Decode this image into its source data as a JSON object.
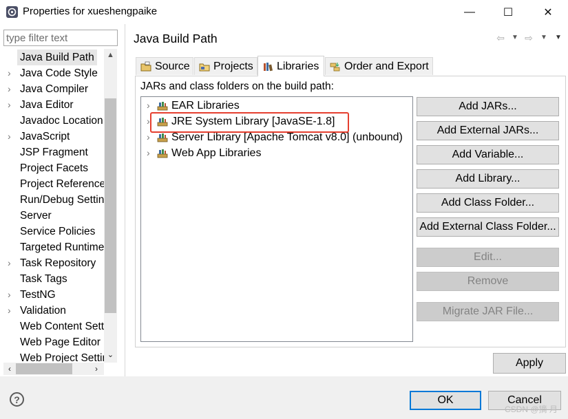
{
  "window": {
    "title": "Properties for xueshengpaike",
    "min_glyph": "—",
    "max_glyph": "☐",
    "close_glyph": "✕"
  },
  "filter": {
    "placeholder": "type filter text",
    "value": ""
  },
  "tree": {
    "items": [
      {
        "label": "Java Build Path",
        "arrow": "",
        "selected": true
      },
      {
        "label": "Java Code Style",
        "arrow": "›"
      },
      {
        "label": "Java Compiler",
        "arrow": "›"
      },
      {
        "label": "Java Editor",
        "arrow": "›"
      },
      {
        "label": "Javadoc Location",
        "arrow": ""
      },
      {
        "label": "JavaScript",
        "arrow": "›"
      },
      {
        "label": "JSP Fragment",
        "arrow": ""
      },
      {
        "label": "Project Facets",
        "arrow": ""
      },
      {
        "label": "Project References",
        "arrow": ""
      },
      {
        "label": "Run/Debug Settings",
        "arrow": ""
      },
      {
        "label": "Server",
        "arrow": ""
      },
      {
        "label": "Service Policies",
        "arrow": ""
      },
      {
        "label": "Targeted Runtimes",
        "arrow": ""
      },
      {
        "label": "Task Repository",
        "arrow": "›"
      },
      {
        "label": "Task Tags",
        "arrow": ""
      },
      {
        "label": "TestNG",
        "arrow": "›"
      },
      {
        "label": "Validation",
        "arrow": "›"
      },
      {
        "label": "Web Content Settings",
        "arrow": ""
      },
      {
        "label": "Web Page Editor",
        "arrow": ""
      },
      {
        "label": "Web Project Settings",
        "arrow": ""
      }
    ]
  },
  "page": {
    "title": "Java Build Path",
    "nav_back": "⇦",
    "nav_fwd": "⇨",
    "menu_glyph": "▼"
  },
  "tabs": [
    {
      "label": "Source",
      "active": false
    },
    {
      "label": "Projects",
      "active": false
    },
    {
      "label": "Libraries",
      "active": true
    },
    {
      "label": "Order and Export",
      "active": false
    }
  ],
  "libraries": {
    "heading": "JARs and class folders on the build path:",
    "items": [
      {
        "label": "EAR Libraries"
      },
      {
        "label": "JRE System Library [JavaSE-1.8]",
        "highlighted": true
      },
      {
        "label": "Server Library [Apache Tomcat v8.0] (unbound)"
      },
      {
        "label": "Web App Libraries"
      }
    ]
  },
  "buttons": {
    "add_jars": "Add JARs...",
    "add_external_jars": "Add External JARs...",
    "add_variable": "Add Variable...",
    "add_library": "Add Library...",
    "add_class_folder": "Add Class Folder...",
    "add_external_class_folder": "Add External Class Folder...",
    "edit": "Edit...",
    "remove": "Remove",
    "migrate_jar": "Migrate JAR File...",
    "apply": "Apply",
    "ok": "OK",
    "cancel": "Cancel"
  },
  "help": {
    "glyph": "?"
  },
  "watermark": "CSDN @摘 月",
  "colors": {
    "highlight": "#e53e2e",
    "ok_border": "#0078d7",
    "disabled_text": "#838383"
  }
}
